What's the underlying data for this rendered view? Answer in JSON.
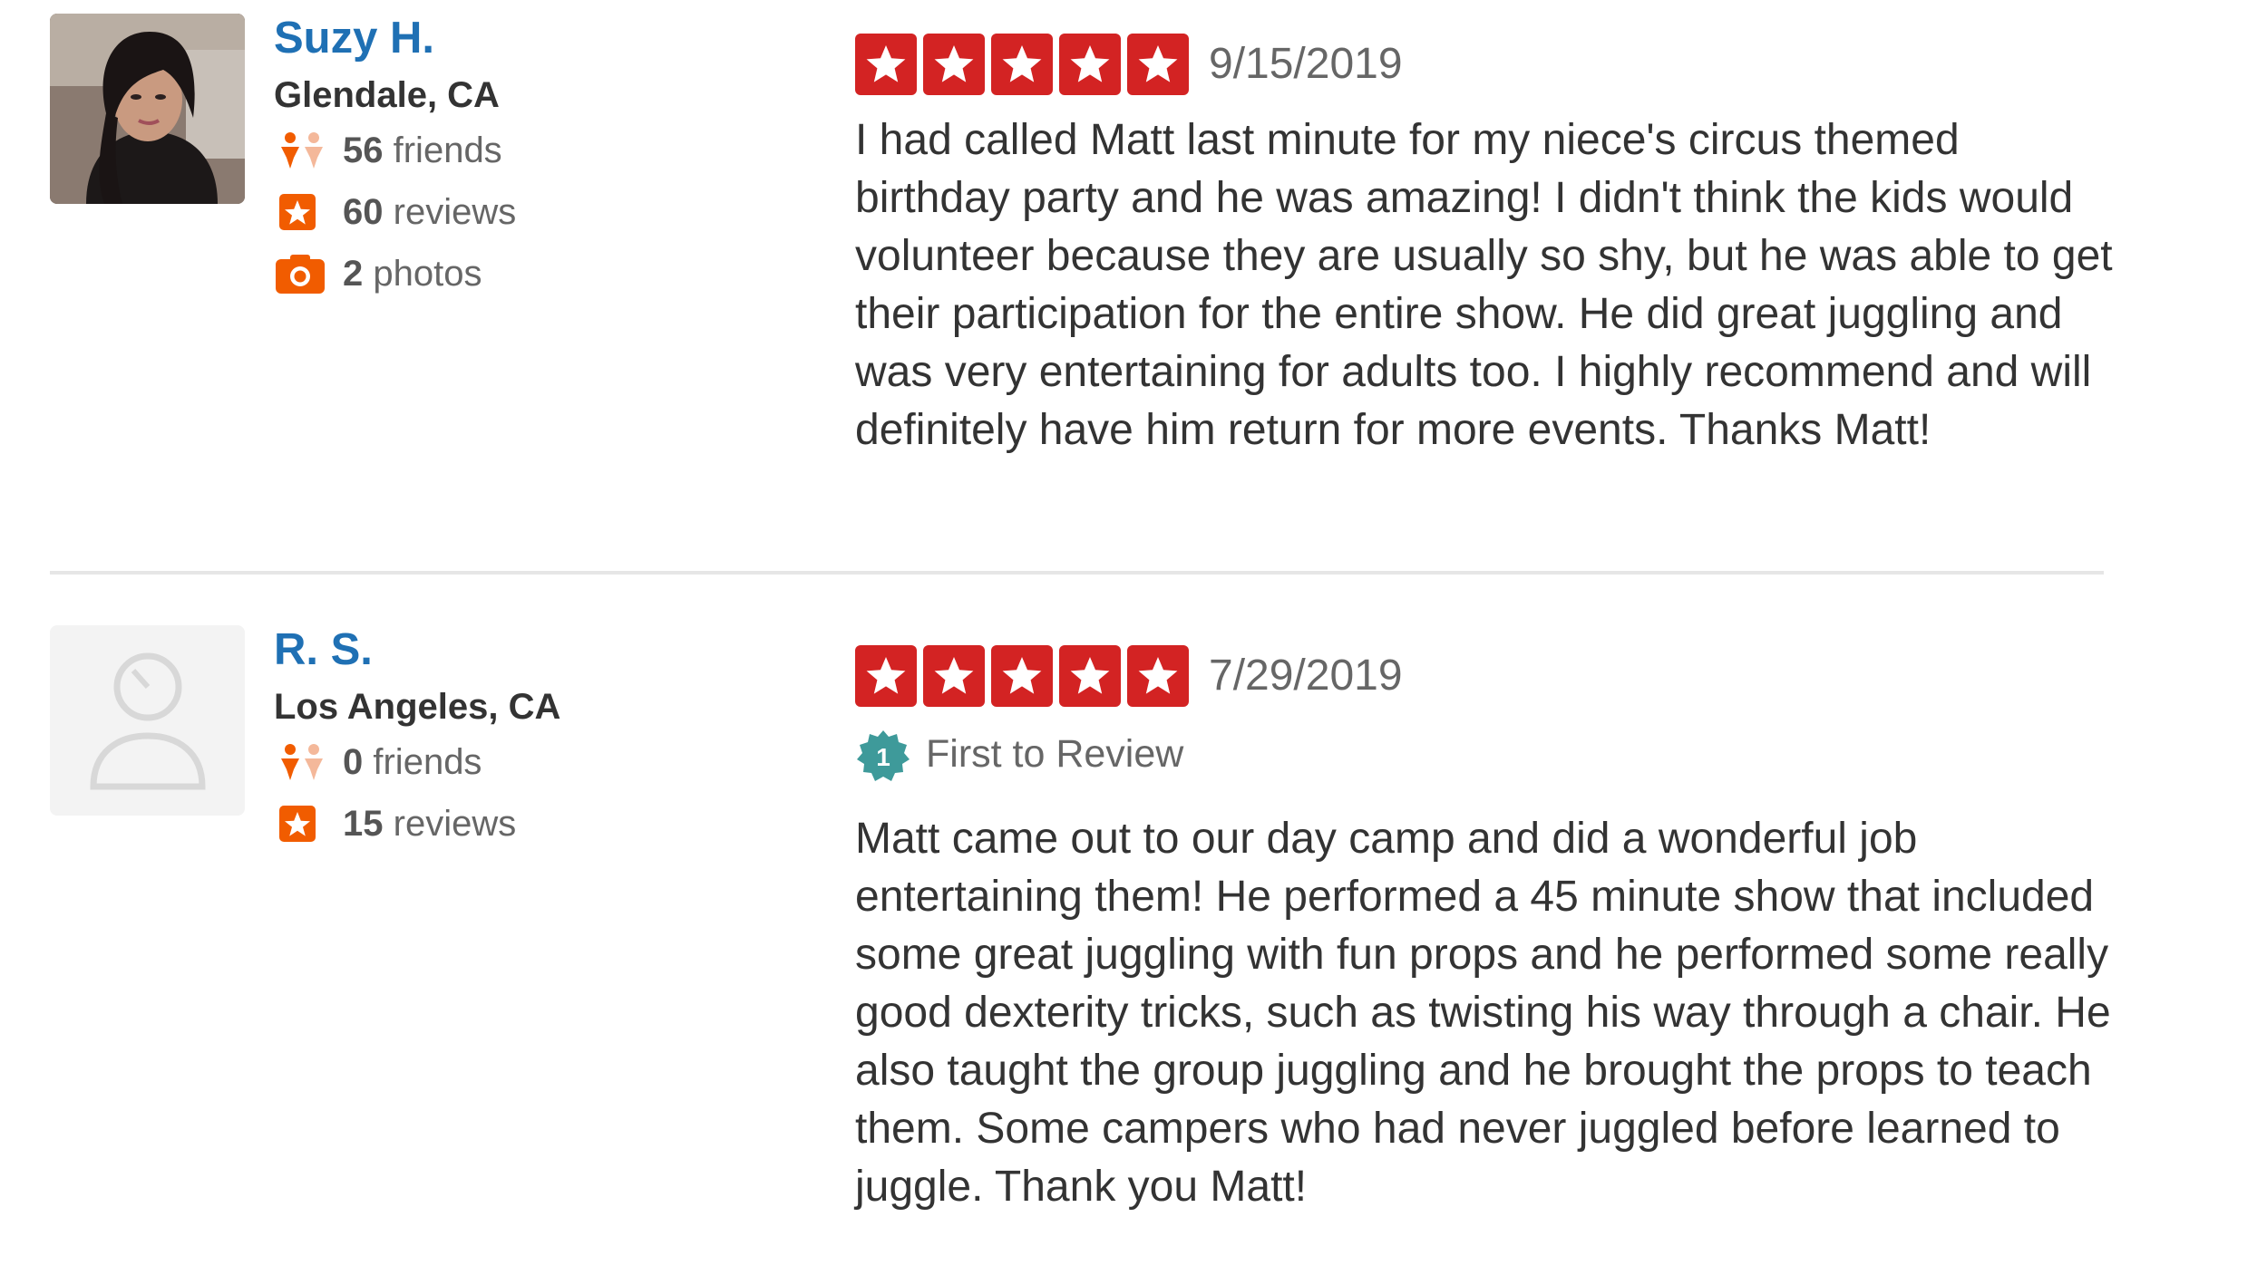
{
  "reviews": [
    {
      "user": {
        "name": "Suzy H.",
        "location": "Glendale, CA",
        "friends_count": "56",
        "friends_label": "friends",
        "reviews_count": "60",
        "reviews_label": "reviews",
        "photos_count": "2",
        "photos_label": "photos"
      },
      "rating": 5,
      "date": "9/15/2019",
      "text": "I had called Matt last minute for my niece's circus themed birthday party and he was amazing! I didn't think the kids would volunteer because they are usually so shy, but he was able to get their participation for the entire show. He did great juggling and was very entertaining for adults too. I highly recommend and will definitely have him return for more events. Thanks Matt!"
    },
    {
      "user": {
        "name": "R. S.",
        "location": "Los Angeles, CA",
        "friends_count": "0",
        "friends_label": "friends",
        "reviews_count": "15",
        "reviews_label": "reviews"
      },
      "rating": 5,
      "date": "7/29/2019",
      "badge": {
        "number": "1",
        "label": "First to Review"
      },
      "text": "Matt came out to our day camp and did a wonderful job entertaining them! He performed a 45 minute show that included some great juggling with fun props and he performed some really good dexterity tricks, such as twisting his way through a chair. He also taught the group juggling and he brought the props to teach them. Some campers who had never juggled before learned to juggle. Thank you Matt!"
    }
  ],
  "colors": {
    "star_red": "#d32323",
    "name_blue": "#1f70b4",
    "stat_orange": "#f15c00",
    "badge_teal": "#3e9a9a"
  },
  "icons": {
    "friends": "friends-icon",
    "reviews": "review-star-icon",
    "photos": "camera-icon",
    "badge": "first-to-review-badge-icon",
    "star": "star-icon"
  }
}
